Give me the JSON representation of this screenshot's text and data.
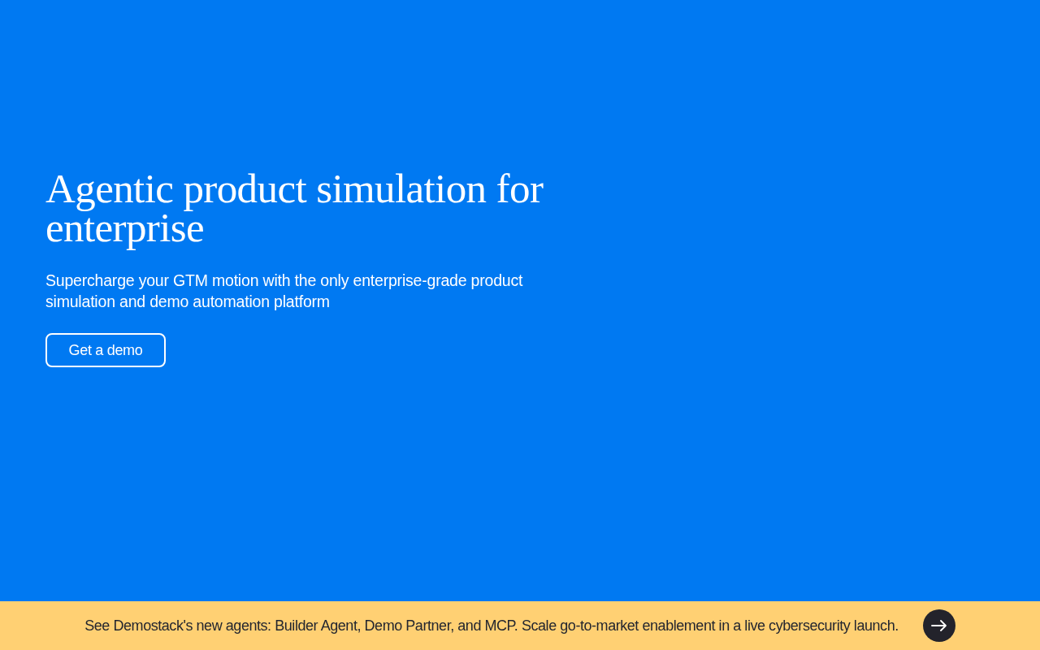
{
  "hero": {
    "heading": "Agentic product simulation for enterprise",
    "subheading": "Supercharge your GTM motion with the only enterprise-grade product simulation and demo automation platform",
    "cta": "Get a demo"
  },
  "announcement_bar": {
    "text": "See Demostack's new agents: Builder Agent, Demo Partner, and MCP. Scale go-to-market enablement in a live cybersecurity launch."
  }
}
